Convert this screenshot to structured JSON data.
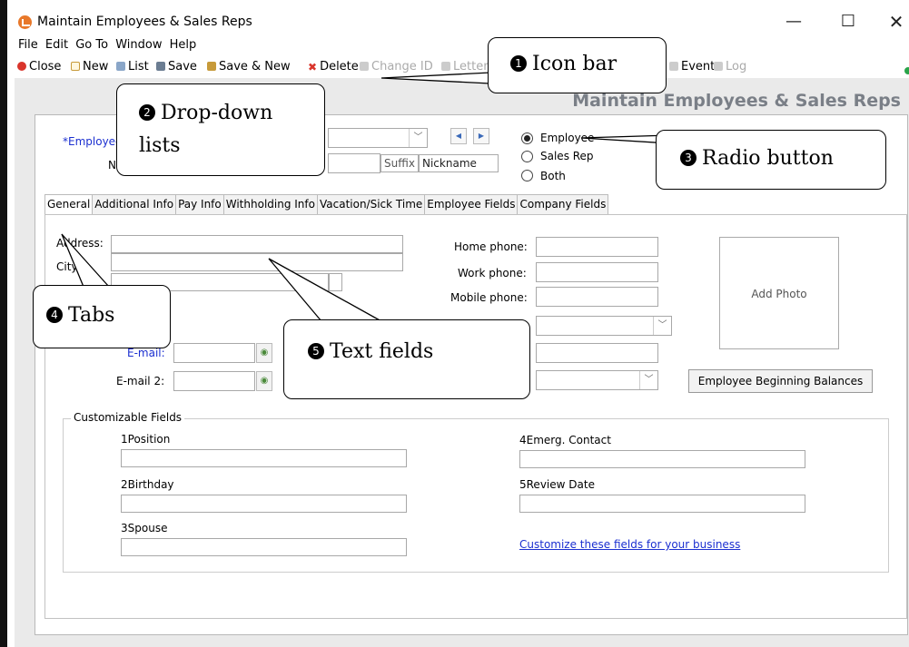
{
  "window": {
    "title": "Maintain Employees & Sales Reps",
    "controls": {
      "minimize": "—",
      "maximize": "☐",
      "close": "✕"
    }
  },
  "menu": [
    "File",
    "Edit",
    "Go To",
    "Window",
    "Help"
  ],
  "toolbar": {
    "close": "Close",
    "new": "New",
    "list": "List",
    "save": "Save",
    "save_new": "Save & New",
    "delete": "Delete",
    "change_id": "Change ID",
    "letters": "Letters",
    "event": "Event",
    "log": "Log"
  },
  "heading": "Maintain Employees & Sales Reps",
  "employee": {
    "id_label": "*Employee",
    "name_label": "Na",
    "suffix": "Suffix",
    "nickname": "Nickname"
  },
  "radios": {
    "selected": "Employee",
    "options": [
      "Employee",
      "Sales Rep",
      "Both"
    ]
  },
  "tabs": [
    "General",
    "Additional Info",
    "Pay Info",
    "Withholding Info",
    "Vacation/Sick Time",
    "Employee Fields",
    "Company Fields"
  ],
  "active_tab": "General",
  "general": {
    "address_label": "Address:",
    "city_label": "City",
    "email_label": "E-mail:",
    "email2_label": "E-mail 2:",
    "home_phone": "Home phone:",
    "work_phone": "Work phone:",
    "mobile_phone": "Mobile phone:",
    "add_photo": "Add Photo",
    "beginning_balances": "Employee Beginning Balances"
  },
  "custom_fields": {
    "title": "Customizable Fields",
    "fields": [
      "1Position",
      "2Birthday",
      "3Spouse",
      "4Emerg. Contact",
      "5Review Date"
    ],
    "link": "Customize these fields for your business"
  },
  "callouts": {
    "c1": {
      "num": "1",
      "text": "Icon bar"
    },
    "c2": {
      "num": "2",
      "text1": "Drop-down",
      "text2": "lists"
    },
    "c3": {
      "num": "3",
      "text": "Radio button"
    },
    "c4": {
      "num": "4",
      "text": "Tabs"
    },
    "c5": {
      "num": "5",
      "text": "Text fields"
    }
  }
}
